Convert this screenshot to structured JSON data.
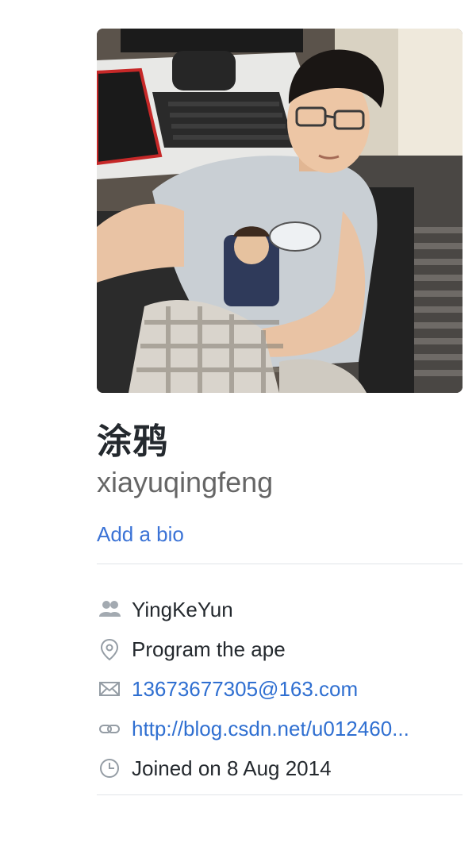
{
  "profile": {
    "avatar_icon": "user-photo",
    "fullname": "涂鸦",
    "username": "xiayuqingfeng",
    "add_bio_label": "Add a bio"
  },
  "details": {
    "organization": "YingKeYun",
    "location": "Program the ape",
    "email": "13673677305@163.com",
    "website": "http://blog.csdn.net/u012460...",
    "joined": "Joined on 8 Aug 2014"
  },
  "icons": {
    "organization": "people-icon",
    "location": "location-pin-icon",
    "email": "mail-icon",
    "website": "link-icon",
    "joined": "clock-icon"
  },
  "colors": {
    "link": "#2f6fd1",
    "text": "#24292e",
    "muted": "#666666",
    "icon": "#959da5",
    "divider": "#e1e4e8"
  }
}
